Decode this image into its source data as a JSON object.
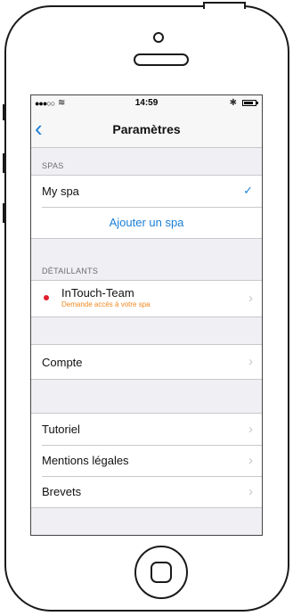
{
  "status_bar": {
    "signal": "●●●○○",
    "wifi": "wifi-icon",
    "time": "14:59",
    "bluetooth": "bluetooth-icon",
    "battery_level": 0.85
  },
  "nav": {
    "back_icon": "chevron-left-icon",
    "title": "Paramètres"
  },
  "spas": {
    "header": "SPAS",
    "items": [
      {
        "label": "My spa",
        "selected": true
      }
    ],
    "add_label": "Ajouter un spa"
  },
  "retailers": {
    "header": "DÉTAILLANTS",
    "items": [
      {
        "name": "InTouch-Team",
        "status": "Demande accès à votre spa"
      }
    ]
  },
  "account": {
    "label": "Compte"
  },
  "info": {
    "items": [
      {
        "label": "Tutoriel"
      },
      {
        "label": "Mentions légales"
      },
      {
        "label": "Brevets"
      }
    ]
  },
  "colors": {
    "accent": "#1a7fd9",
    "status_dot": "#e0202a",
    "pending_text": "#f0891e",
    "background": "#efeff4"
  }
}
